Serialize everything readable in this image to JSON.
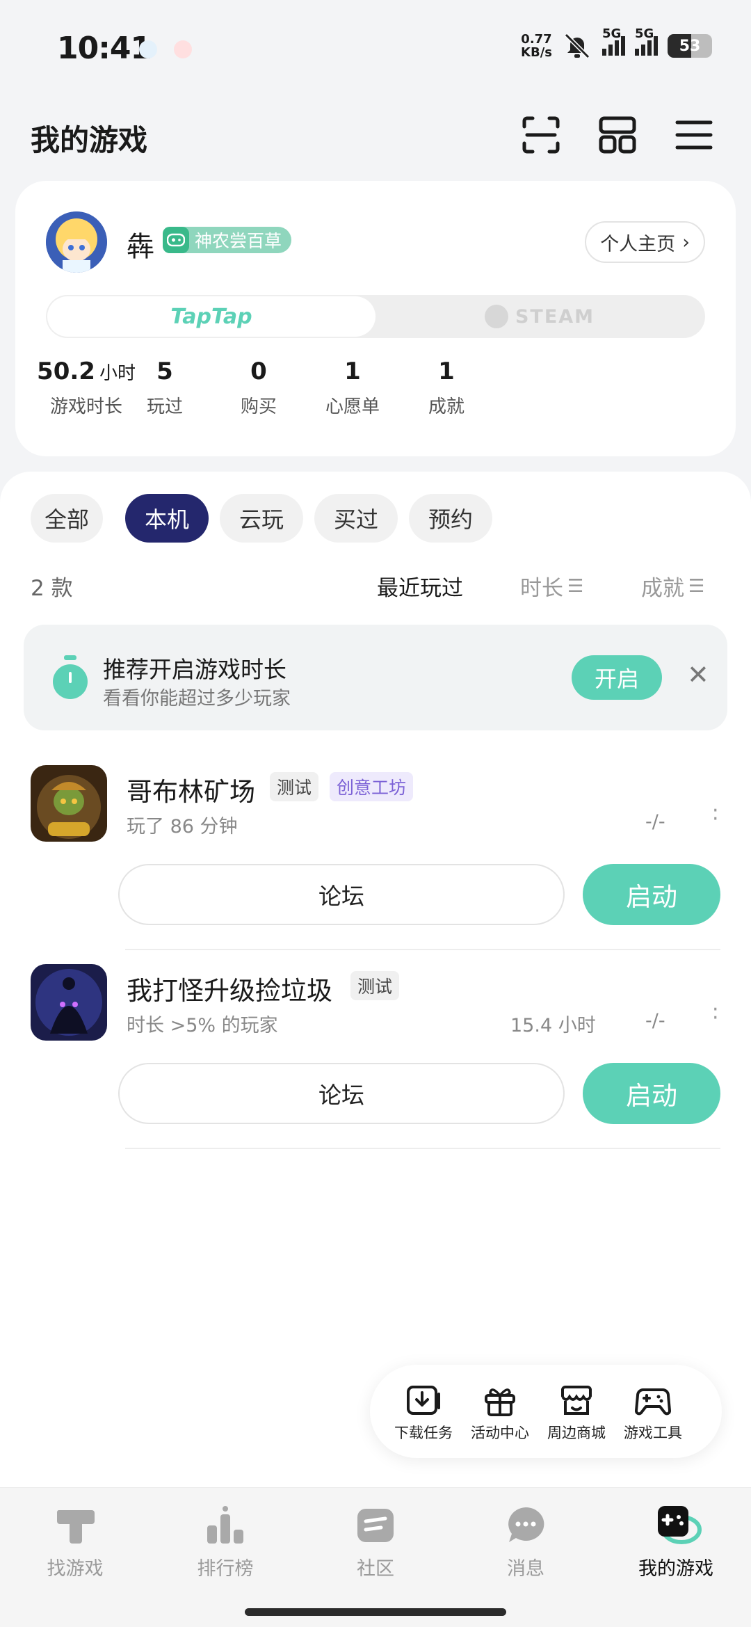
{
  "status_bar": {
    "time": "10:41",
    "net_speed_value": "0.77",
    "net_speed_unit": "KB/s",
    "signal1": "5G",
    "signal2": "5G",
    "battery": "53"
  },
  "header": {
    "title": "我的游戏"
  },
  "profile": {
    "username": "犇",
    "badge": "神农尝百草",
    "home_button": "个人主页",
    "platforms": [
      "TapTap",
      "STEAM"
    ],
    "stats": [
      {
        "value": "50.2",
        "unit": "小时",
        "label": "游戏时长"
      },
      {
        "value": "5",
        "unit": "",
        "label": "玩过"
      },
      {
        "value": "0",
        "unit": "",
        "label": "购买"
      },
      {
        "value": "1",
        "unit": "",
        "label": "心愿单"
      },
      {
        "value": "1",
        "unit": "",
        "label": "成就"
      }
    ]
  },
  "filters": {
    "chips": [
      "全部",
      "本机",
      "云玩",
      "买过",
      "预约"
    ],
    "active": "本机",
    "count": "2 款",
    "sort": [
      "最近玩过",
      "时长",
      "成就"
    ]
  },
  "reminder": {
    "title": "推荐开启游戏时长",
    "subtitle": "看看你能超过多少玩家",
    "button": "开启"
  },
  "games": [
    {
      "name": "哥布林矿场",
      "tags": [
        "测试",
        "创意工坊"
      ],
      "sub": "玩了 86 分钟",
      "hours": "",
      "rating": "-/-",
      "forum": "论坛",
      "launch": "启动"
    },
    {
      "name": "我打怪升级捡垃圾",
      "tags": [
        "测试"
      ],
      "sub": "时长 >5% 的玩家",
      "hours": "15.4 小时",
      "rating": "-/-",
      "forum": "论坛",
      "launch": "启动"
    }
  ],
  "tools": [
    "下载任务",
    "活动中心",
    "周边商城",
    "游戏工具"
  ],
  "nav": {
    "items": [
      "找游戏",
      "排行榜",
      "社区",
      "消息",
      "我的游戏"
    ],
    "active": "我的游戏"
  },
  "colors": {
    "accent": "#5cd1b6",
    "active_chip": "#24276d",
    "badge": "#8fd6bd"
  }
}
